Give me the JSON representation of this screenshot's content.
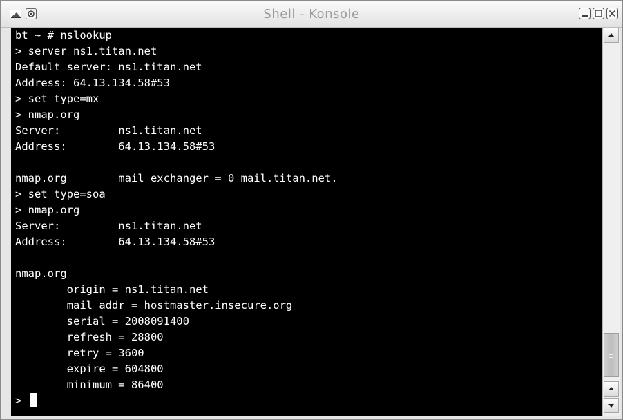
{
  "window": {
    "title": "Shell - Konsole",
    "icons": [
      "konsole-app-icon",
      "sticky-pin-icon"
    ],
    "buttons": [
      "minimize-icon",
      "maximize-icon",
      "close-icon"
    ]
  },
  "terminal": {
    "lines": [
      "bt ~ # nslookup",
      "> server ns1.titan.net",
      "Default server: ns1.titan.net",
      "Address: 64.13.134.58#53",
      "> set type=mx",
      "> nmap.org",
      "Server:         ns1.titan.net",
      "Address:        64.13.134.58#53",
      "",
      "nmap.org        mail exchanger = 0 mail.titan.net.",
      "> set type=soa",
      "> nmap.org",
      "Server:         ns1.titan.net",
      "Address:        64.13.134.58#53",
      "",
      "nmap.org",
      "        origin = ns1.titan.net",
      "        mail addr = hostmaster.insecure.org",
      "        serial = 2008091400",
      "        refresh = 28800",
      "        retry = 3600",
      "        expire = 604800",
      "        minimum = 86400",
      "> "
    ]
  },
  "scrollbar": {
    "icons": [
      "scroll-up-arrow-icon",
      "scroll-down-arrow-icon"
    ],
    "position_fraction": 1.0
  }
}
